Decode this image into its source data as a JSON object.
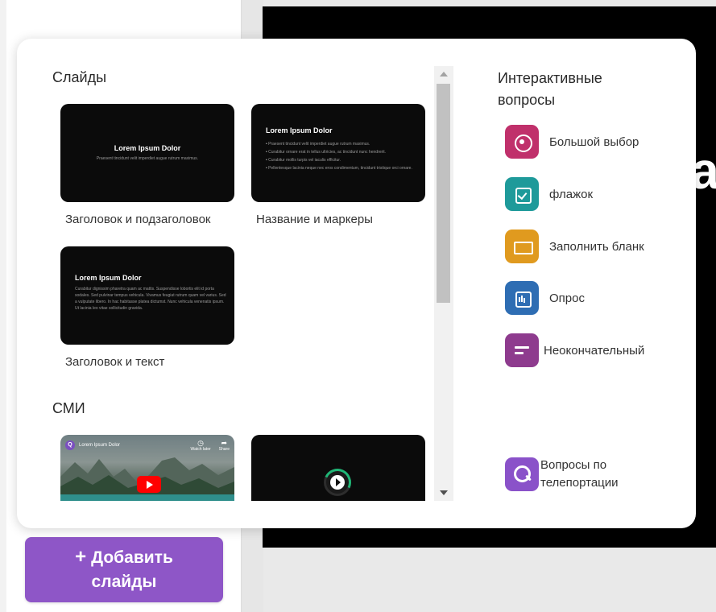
{
  "popup": {
    "slides_section": {
      "title": "Слайды",
      "items": [
        {
          "label": "Заголовок и подзаголовок",
          "thumb_title": "Lorem Ipsum Dolor",
          "thumb_subtitle": "Praesent tincidunt velit imperdiet augue rutrum maximus."
        },
        {
          "label": "Название и маркеры",
          "thumb_title": "Lorem Ipsum Dolor",
          "thumb_bullets": [
            "Praesent tincidunt velit imperdiet augue rutrum maximus.",
            "Curabitur ornare erat in tellus ultricies, ac tincidunt nunc hendrerit.",
            "Curabitur mollis turpis vel iaculis efficitur.",
            "Pellentesque lacinia neque nec eros condimentum, tincidunt tristique orci ornare."
          ]
        },
        {
          "label": "Заголовок и текст",
          "thumb_title": "Lorem Ipsum Dolor",
          "thumb_subtitle": "Curabitur dignissim pharetra quam ac mattis. Suspendisse lobortis elit id porta sodales. Sed pulvinar tempus vehicula. Vivamus feugiat rutrum quam vel varius. Sed a vulputate libero. In hac habitasse platea dictumst. Nunc vehicula venenatis ipsum. Ut lacinia leo vitae sollicitudin gravida."
        }
      ]
    },
    "media_section": {
      "title": "СМИ",
      "video": {
        "avatar_letter": "Q",
        "title": "Lorem Ipsum Dolor",
        "action_watch_later": "Watch later",
        "action_share": "Share"
      }
    },
    "interactive_section": {
      "title": "Интерактивные вопросы",
      "items": [
        {
          "label": "Большой выбор",
          "icon": "radio-icon",
          "color": "#c0306b"
        },
        {
          "label": "флажок",
          "icon": "checkbox-icon",
          "color": "#1e9a9a"
        },
        {
          "label": "Заполнить бланк",
          "icon": "fill-blank-icon",
          "color": "#e09a1f"
        },
        {
          "label": "Опрос",
          "icon": "poll-icon",
          "color": "#2e6db3"
        },
        {
          "label": "Неоконча­тельный",
          "icon": "open-ended-icon",
          "color": "#8e3b8e"
        },
        {
          "label": "Вопросы по телепортации",
          "icon": "search-icon",
          "color": "#8a52c9"
        }
      ]
    }
  },
  "add_slides_button": {
    "plus": "+",
    "line1": "Добавить",
    "line2": "слайды",
    "color": "#8e56c7"
  },
  "editor": {
    "visible_letter": "a"
  }
}
